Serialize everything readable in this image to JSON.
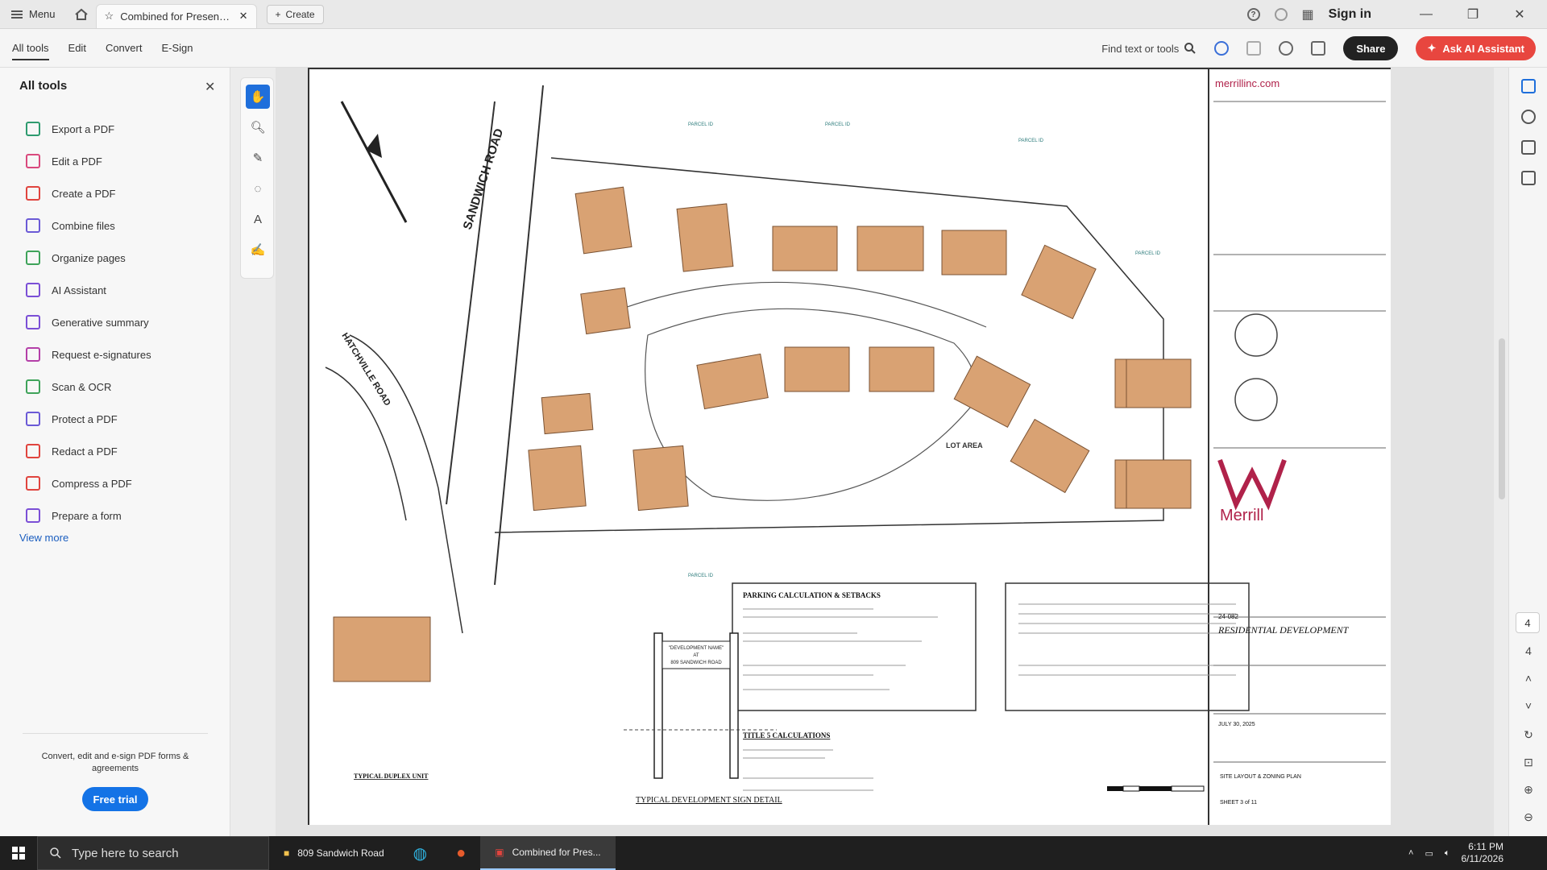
{
  "tabbar": {
    "menu_label": "Menu",
    "doc_tab_title": "Combined for Presentati...",
    "create_label": "Create",
    "signin_label": "Sign in"
  },
  "toolbar": {
    "tabs": [
      "All tools",
      "Edit",
      "Convert",
      "E-Sign"
    ],
    "find_label": "Find text or tools",
    "share_label": "Share",
    "ai_label": "Ask AI Assistant"
  },
  "left_panel": {
    "title": "All tools",
    "tools": [
      {
        "label": "Export a PDF",
        "color": "#2e9b6f"
      },
      {
        "label": "Edit a PDF",
        "color": "#d9497d"
      },
      {
        "label": "Create a PDF",
        "color": "#e0443e"
      },
      {
        "label": "Combine files",
        "color": "#6b5ad6"
      },
      {
        "label": "Organize pages",
        "color": "#3fa35a"
      },
      {
        "label": "AI Assistant",
        "color": "#7b4fd6"
      },
      {
        "label": "Generative summary",
        "color": "#7b4fd6"
      },
      {
        "label": "Request e-signatures",
        "color": "#b43fa8"
      },
      {
        "label": "Scan & OCR",
        "color": "#3fa35a"
      },
      {
        "label": "Protect a PDF",
        "color": "#6b5ad6"
      },
      {
        "label": "Redact a PDF",
        "color": "#e0443e"
      },
      {
        "label": "Compress a PDF",
        "color": "#e0443e"
      },
      {
        "label": "Prepare a form",
        "color": "#7b4fd6"
      }
    ],
    "view_more": "View more",
    "promo": "Convert, edit and e-sign PDF forms & agreements",
    "trial_label": "Free trial"
  },
  "document": {
    "road_1": "SANDWICH ROAD",
    "road_2": "HATCHVILLE ROAD",
    "lot_area": "LOT AREA",
    "parking_title": "PARKING CALCULATION & SETBACKS",
    "title5_title": "TITLE 5 CALCULATIONS",
    "duplex_label": "TYPICAL DUPLEX UNIT",
    "sign_detail": "TYPICAL DEVELOPMENT SIGN DETAIL",
    "dev_name": "\"DEVELOPMENT NAME\"",
    "dev_at": "AT",
    "dev_addr": "809 SANDWICH ROAD",
    "title_block_url": "merrillinc.com",
    "company": "Merrill",
    "project_type": "RESIDENTIAL DEVELOPMENT",
    "sheet_title": "SITE LAYOUT & ZONING PLAN",
    "sheet_no": "SHEET 3 of 11",
    "date": "JULY 30, 2025",
    "sheet_code": "24-082"
  },
  "right_rail": {
    "page_current": "4",
    "page_total": "4"
  },
  "taskbar": {
    "search_placeholder": "Type here to search",
    "app_1": "809 Sandwich Road",
    "app_2": "Combined for Pres...",
    "time": "6:11 PM",
    "date": "6/11/2026"
  },
  "colors": {
    "accent_blue": "#1473e6",
    "ai_red": "#e8463f",
    "building": "#d9a273"
  }
}
